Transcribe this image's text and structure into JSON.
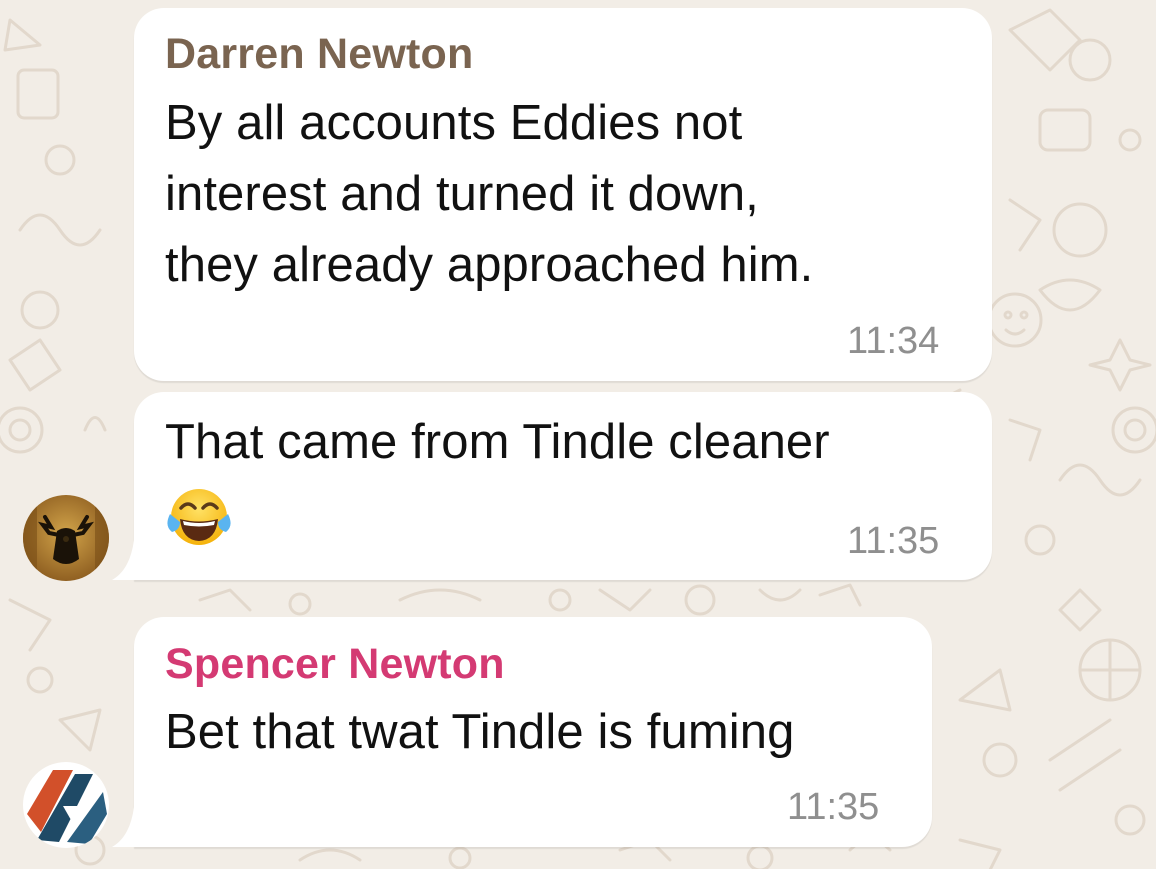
{
  "messages": [
    {
      "sender": "Darren Newton",
      "sender_color": "#7a6450",
      "lines": [
        "By all accounts Eddies not",
        "interest and turned it down,",
        "they already approached him."
      ],
      "time": "11:34"
    },
    {
      "lines": [
        "That came from Tindle cleaner"
      ],
      "emoji": "face-with-tears-of-joy",
      "time": "11:35"
    },
    {
      "sender": "Spencer Newton",
      "sender_color": "#d43a73",
      "lines": [
        "Bet that twat Tindle is fuming"
      ],
      "time": "11:35"
    }
  ],
  "colors": {
    "background": "#f2ede6",
    "bubble": "#ffffff",
    "time": "#8f8f8f",
    "text": "#111111"
  },
  "icons": {
    "avatar_1": "moose-head-avatar",
    "avatar_2": "blue-orange-logo-avatar",
    "emoji": "face-with-tears-of-joy-icon"
  }
}
